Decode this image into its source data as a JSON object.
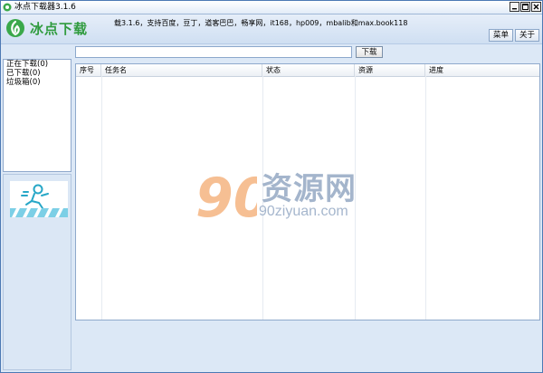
{
  "titlebar": {
    "title": "冰点下载器3.1.6"
  },
  "header": {
    "logo_text": "冰点下载",
    "notice": "载3.1.6，支持百度，豆丁，道客巴巴，畅享网，it168，hp009，mbalib和max.book118",
    "menu_label": "菜单",
    "about_label": "关于"
  },
  "sidebar": {
    "items": [
      {
        "label": "正在下载(0)"
      },
      {
        "label": "已下载(0)"
      },
      {
        "label": "垃圾箱(0)"
      }
    ]
  },
  "urlbar": {
    "value": "",
    "download_label": "下载"
  },
  "list": {
    "columns": [
      {
        "label": "序号"
      },
      {
        "label": "任务名"
      },
      {
        "label": "状态"
      },
      {
        "label": "资源"
      },
      {
        "label": "进度"
      }
    ],
    "rows": []
  },
  "watermark": {
    "number": "90",
    "cn": "资源网",
    "en": "90ziyuan.com"
  },
  "colors": {
    "accent": "#2f9b3e",
    "background": "#dce8f6",
    "border": "#8fa9cc"
  }
}
